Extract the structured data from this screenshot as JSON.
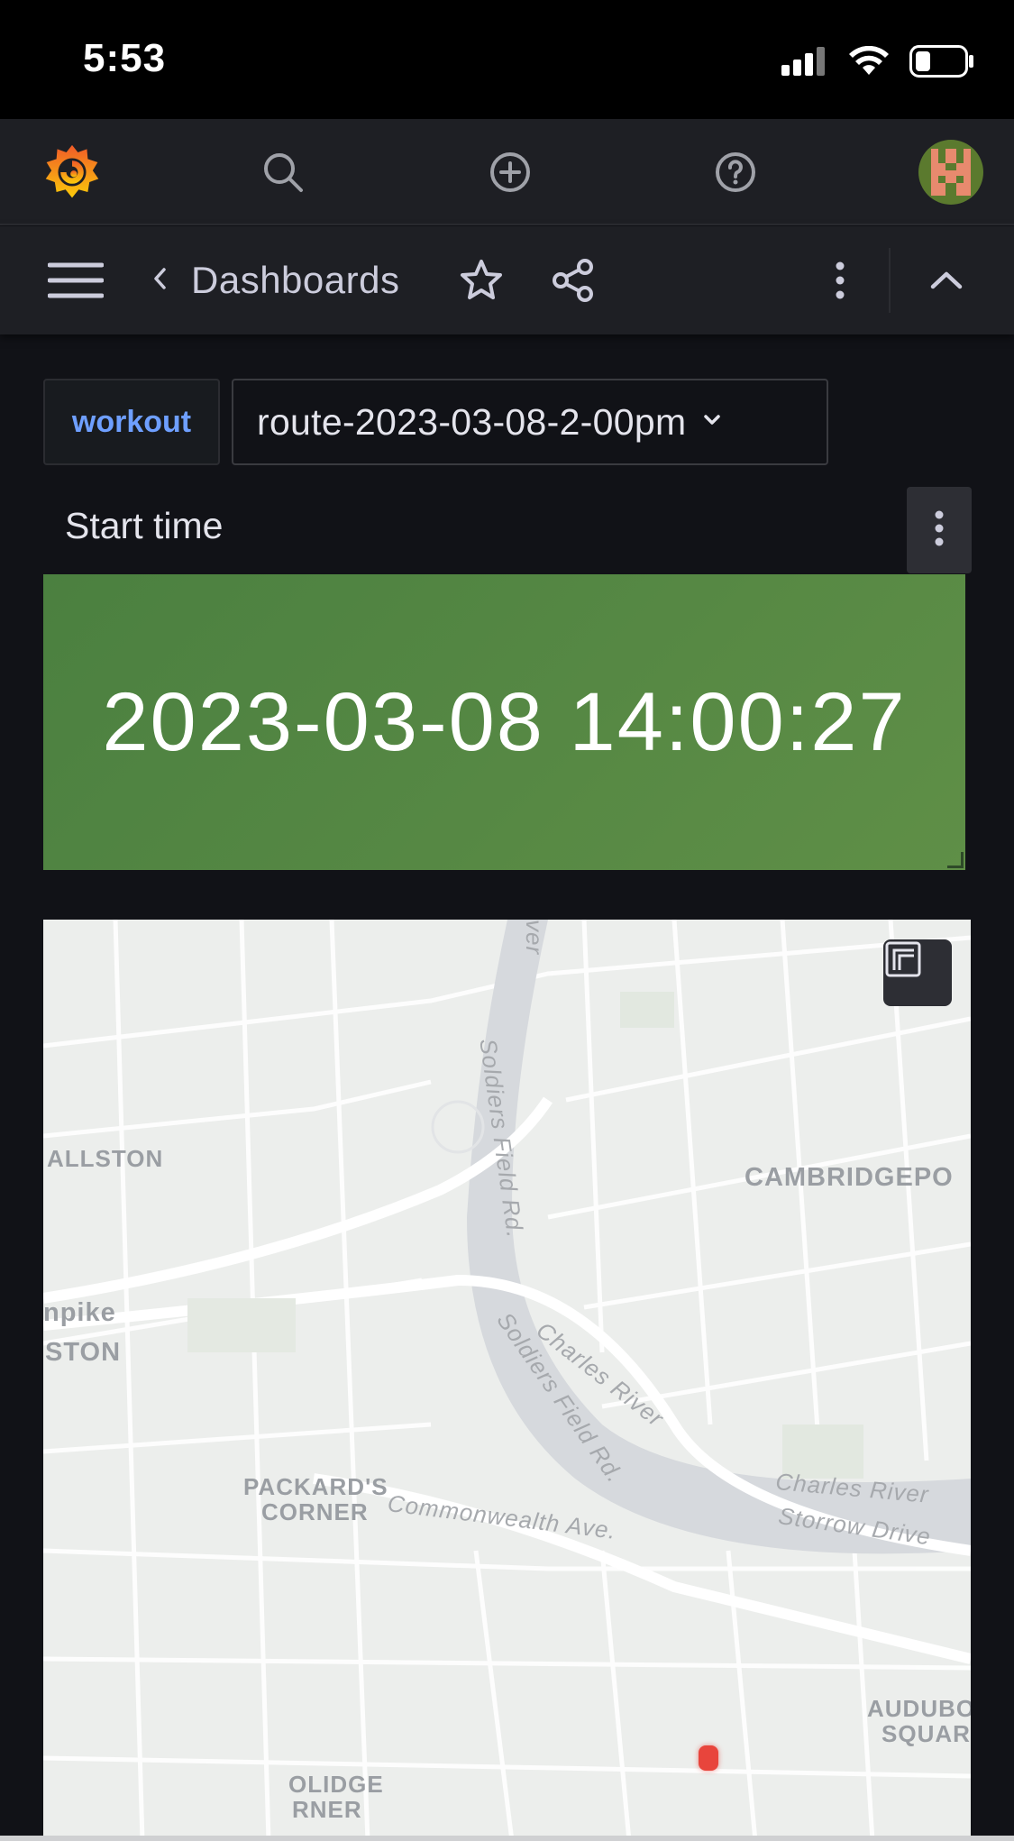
{
  "status_bar": {
    "time": "5:53",
    "icons": [
      "cellular-signal-icon",
      "wifi-icon",
      "battery-icon"
    ]
  },
  "topnav": {
    "logo": "grafana-logo",
    "icons": [
      "search-icon",
      "plus-circle-icon",
      "help-icon",
      "user-avatar"
    ]
  },
  "toolbar": {
    "breadcrumb_label": "Dashboards",
    "icons": [
      "hamburger-menu-icon",
      "chevron-left-icon",
      "star-icon",
      "share-icon",
      "more-vertical-icon",
      "chevron-up-icon"
    ]
  },
  "variables": {
    "label": "workout",
    "selected_value": "route-2023-03-08-2-00pm"
  },
  "stat_panel": {
    "title": "Start time",
    "value": "2023-03-08 14:00:27",
    "background_color": "#56893f"
  },
  "map_panel": {
    "labels": {
      "allston": "ALLSTON",
      "cambridgeport": "CAMBRIDGEPO",
      "pike": "npike",
      "ston": "STON",
      "packards_corner_1": "PACKARD'S",
      "packards_corner_2": "CORNER",
      "audubon_1": "AUDUBO",
      "audubon_2": "SQUAR",
      "coolidge_1": "OLIDGE",
      "coolidge_2": "RNER"
    },
    "road_labels": {
      "soldiers_field_1": "Soldiers Field Rd.",
      "soldiers_field_2": "Soldiers Field Rd.",
      "charles_river_1": "Charles River",
      "charles_river_2": "Charles River",
      "storrow": "Storrow Drive",
      "commonwealth": "Commonwealth Ave.",
      "river_top": "ver"
    }
  }
}
